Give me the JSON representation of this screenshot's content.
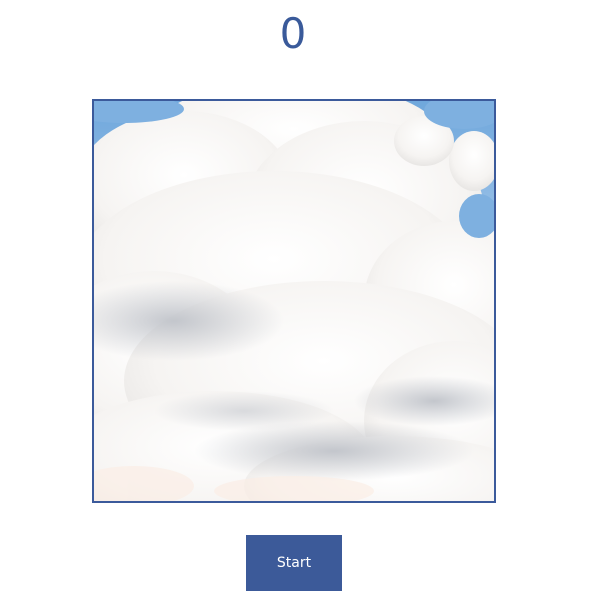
{
  "score": "0",
  "start_button_label": "Start",
  "colors": {
    "accent": "#3c5a99",
    "score_text": "#3a5a9a",
    "sky": "#7aaee0"
  }
}
